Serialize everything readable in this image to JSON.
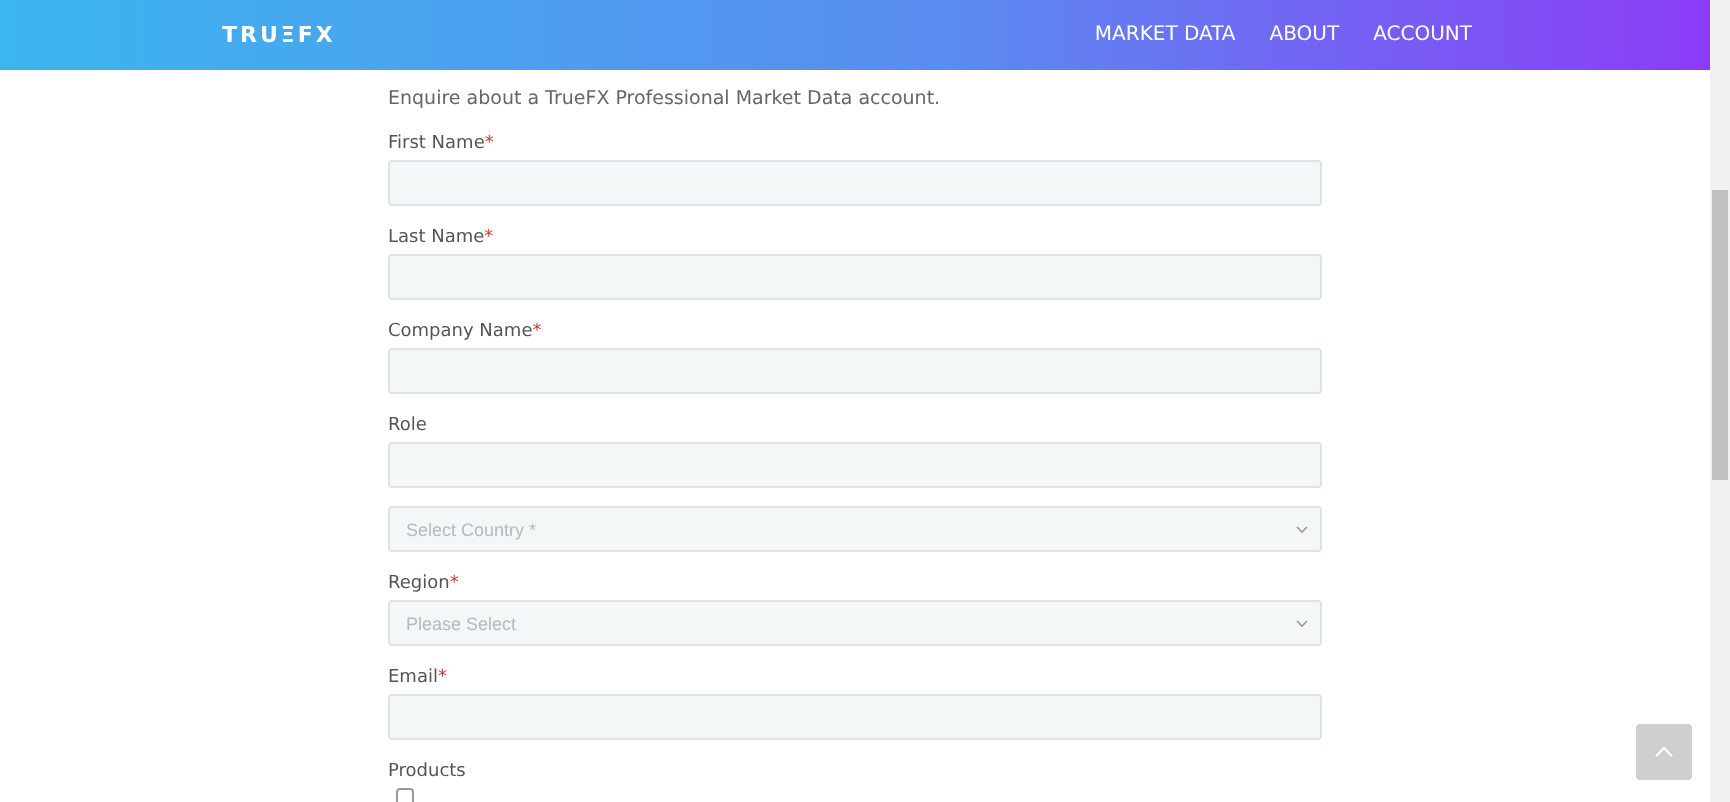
{
  "header": {
    "logo": "TRUΞFX",
    "nav": [
      "MARKET DATA",
      "ABOUT",
      "ACCOUNT"
    ]
  },
  "intro": "Enquire about a TrueFX Professional Market Data account.",
  "fields": [
    {
      "kind": "text",
      "label": "First Name",
      "mark": "*"
    },
    {
      "kind": "text",
      "label": "Last Name",
      "mark": "*"
    },
    {
      "kind": "text",
      "label": "Company Name",
      "mark": "*"
    },
    {
      "kind": "text",
      "label": "Role"
    },
    {
      "kind": "select",
      "placeholder": "Select Country *"
    },
    {
      "kind": "select",
      "label": "Region",
      "mark": "*",
      "placeholder": "Please Select"
    },
    {
      "kind": "text",
      "label": "Email",
      "mark": "*"
    }
  ],
  "products": {
    "label": "Products",
    "options": [
      {
        "checked": false
      }
    ]
  }
}
